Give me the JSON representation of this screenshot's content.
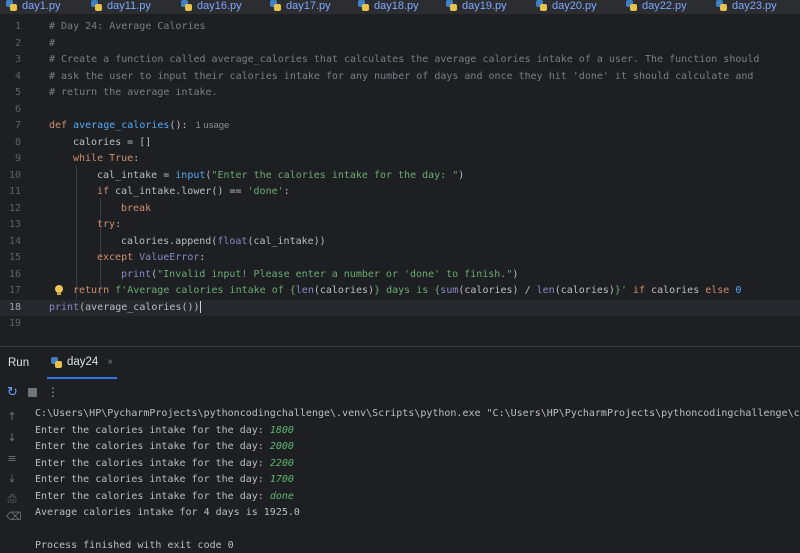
{
  "tabs": [
    {
      "label": "day1.py"
    },
    {
      "label": "day11.py"
    },
    {
      "label": "day16.py"
    },
    {
      "label": "day17.py"
    },
    {
      "label": "day18.py"
    },
    {
      "label": "day19.py"
    },
    {
      "label": "day20.py"
    },
    {
      "label": "day22.py"
    },
    {
      "label": "day23.py"
    }
  ],
  "editor": {
    "line_numbers": [
      "1",
      "2",
      "3",
      "4",
      "5",
      "6",
      "7",
      "8",
      "9",
      "10",
      "11",
      "12",
      "13",
      "14",
      "15",
      "16",
      "17",
      "18",
      "19"
    ],
    "current_line": "18",
    "code": {
      "l1": "# Day 24: Average Calories",
      "l2": "#",
      "l3": "# Create a function called average_calories that calculates the average calories intake of a user. The function should",
      "l4": "# ask the user to input their calories intake for any number of days and once they hit 'done' it should calculate and",
      "l5": "# return the average intake.",
      "l7_kw": "def ",
      "l7_fn": "average_calories",
      "l7_rest": "():",
      "l7_hint": "1 usage",
      "l8": "calories = []",
      "l9_kw": "while ",
      "l9_kw2": "True",
      "l9_rest": ":",
      "l10_a": "cal_intake = ",
      "l10_b": "input",
      "l10_c": "(",
      "l10_d": "\"Enter the calories intake for the day: \"",
      "l10_e": ")",
      "l11_kw": "if ",
      "l11_a": "cal_intake.lower() == ",
      "l11_str": "'done'",
      "l11_b": ":",
      "l12": "break",
      "l13_kw": "try",
      "l13_b": ":",
      "l14_a": "calories.append(",
      "l14_b": "float",
      "l14_c": "(cal_intake))",
      "l15_kw": "except ",
      "l15_exc": "ValueError",
      "l15_b": ":",
      "l16_a": "print",
      "l16_b": "(",
      "l16_str": "\"Invalid input! Please enter a number or 'done' to finish.\"",
      "l16_c": ")",
      "l17_kw": "return ",
      "l17_s1": "f'Average calories intake of {",
      "l17_len1": "len",
      "l17_a": "(calories)",
      "l17_s2": "} days is {",
      "l17_sum": "sum",
      "l17_b": "(calories) / ",
      "l17_len2": "len",
      "l17_c": "(calories)",
      "l17_s3": "}'",
      "l17_kw2": " if ",
      "l17_d": "calories ",
      "l17_kw3": "else ",
      "l17_num": "0",
      "l18_a": "print",
      "l18_b": "(average_calories())"
    }
  },
  "run_panel": {
    "title": "Run",
    "tab_label": "day24",
    "close_glyph": "×",
    "console_lines": [
      {
        "text": "C:\\Users\\HP\\PycharmProjects\\pythoncodingchallenge\\.venv\\Scripts\\python.exe \"C:\\Users\\HP\\PycharmProjects\\pythoncodingchallenge\\c",
        "input": ""
      },
      {
        "text": "Enter the calories intake for the day: ",
        "input": "1800"
      },
      {
        "text": "Enter the calories intake for the day: ",
        "input": "2000"
      },
      {
        "text": "Enter the calories intake for the day: ",
        "input": "2200"
      },
      {
        "text": "Enter the calories intake for the day: ",
        "input": "1700"
      },
      {
        "text": "Enter the calories intake for the day: ",
        "input": "done"
      },
      {
        "text": "Average calories intake for 4 days is 1925.0",
        "input": ""
      },
      {
        "text": "",
        "input": ""
      },
      {
        "text": "Process finished with exit code 0",
        "input": ""
      }
    ]
  },
  "colors": {
    "background": "#1e1f22",
    "keyword": "#cf8e6d",
    "function": "#56a8f5",
    "string": "#6aab73",
    "comment": "#7a7e85",
    "accent": "#3574f0"
  },
  "icons": {
    "tab_file": "python-file-icon",
    "rerun": "rerun-icon",
    "stop": "stop-icon",
    "more": "more-options-icon",
    "bulb": "lightbulb-icon"
  }
}
